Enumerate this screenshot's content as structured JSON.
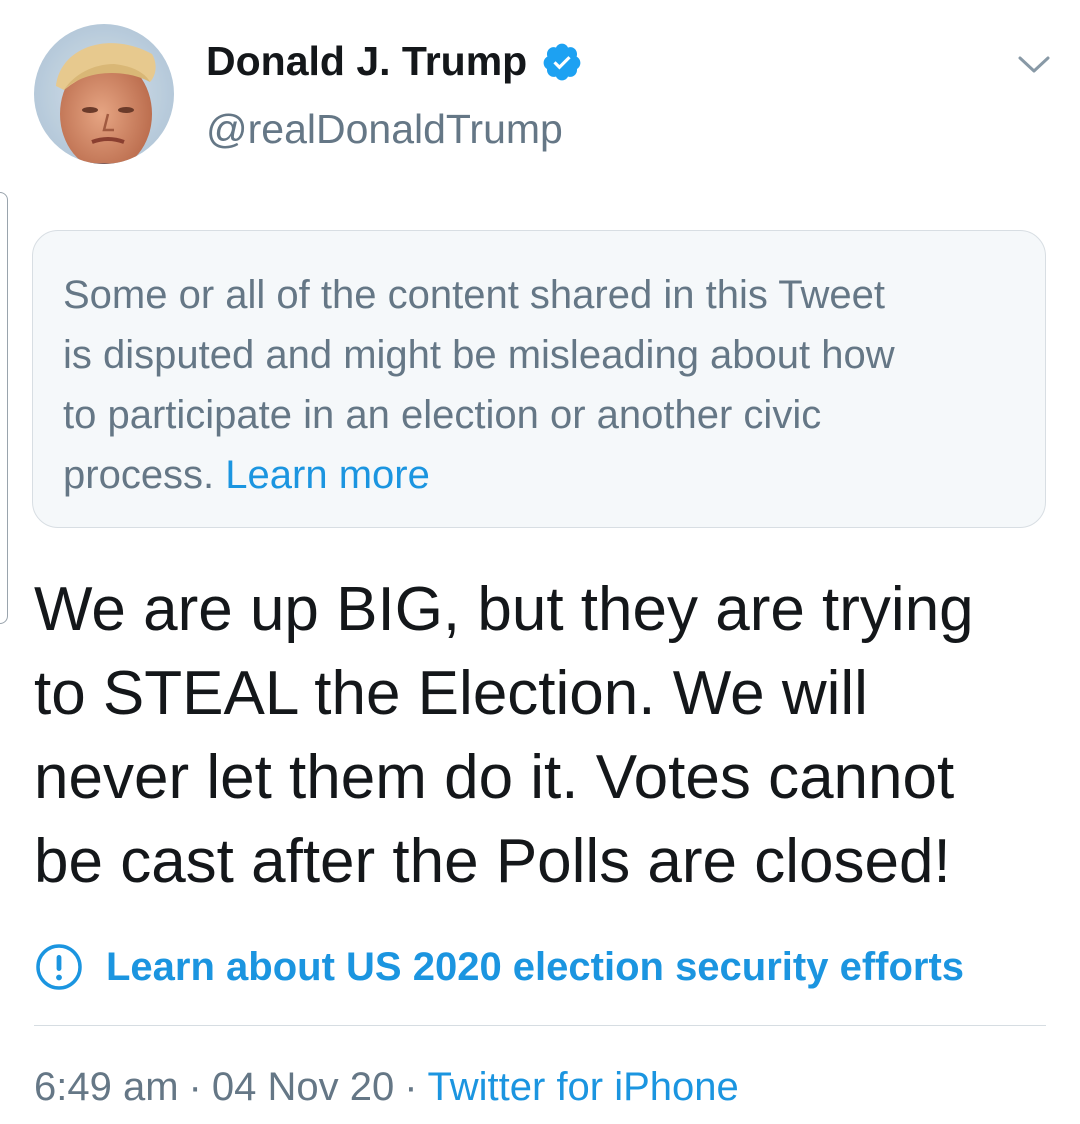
{
  "author": {
    "display_name": "Donald J. Trump",
    "handle": "@realDonaldTrump",
    "verified_icon": "verified-badge-icon",
    "avatar": "profile-photo",
    "menu_icon": "chevron-down-icon"
  },
  "notice": {
    "lines": [
      "Some or all of the content shared in this Tweet",
      "is disputed and might be misleading about how",
      "to participate in an election or another civic"
    ],
    "last_line_text": "process.",
    "link_text": "Learn more"
  },
  "tweet": {
    "lines": [
      "We are up BIG, but they are trying",
      "to STEAL the Election. We will",
      "never let them do it. Votes cannot",
      "be cast after the Polls are closed!"
    ]
  },
  "info": {
    "icon": "exclamation-circle-icon",
    "link_text": "Learn about US 2020 election security efforts"
  },
  "meta": {
    "time": "6:49 am",
    "date": "04 Nov 20",
    "separator": "·",
    "source": "Twitter for iPhone"
  },
  "colors": {
    "link": "#1b95e0",
    "text_primary": "#14171a",
    "text_secondary": "#657786",
    "notice_bg": "#f5f8fa",
    "border": "#d6dde2"
  }
}
